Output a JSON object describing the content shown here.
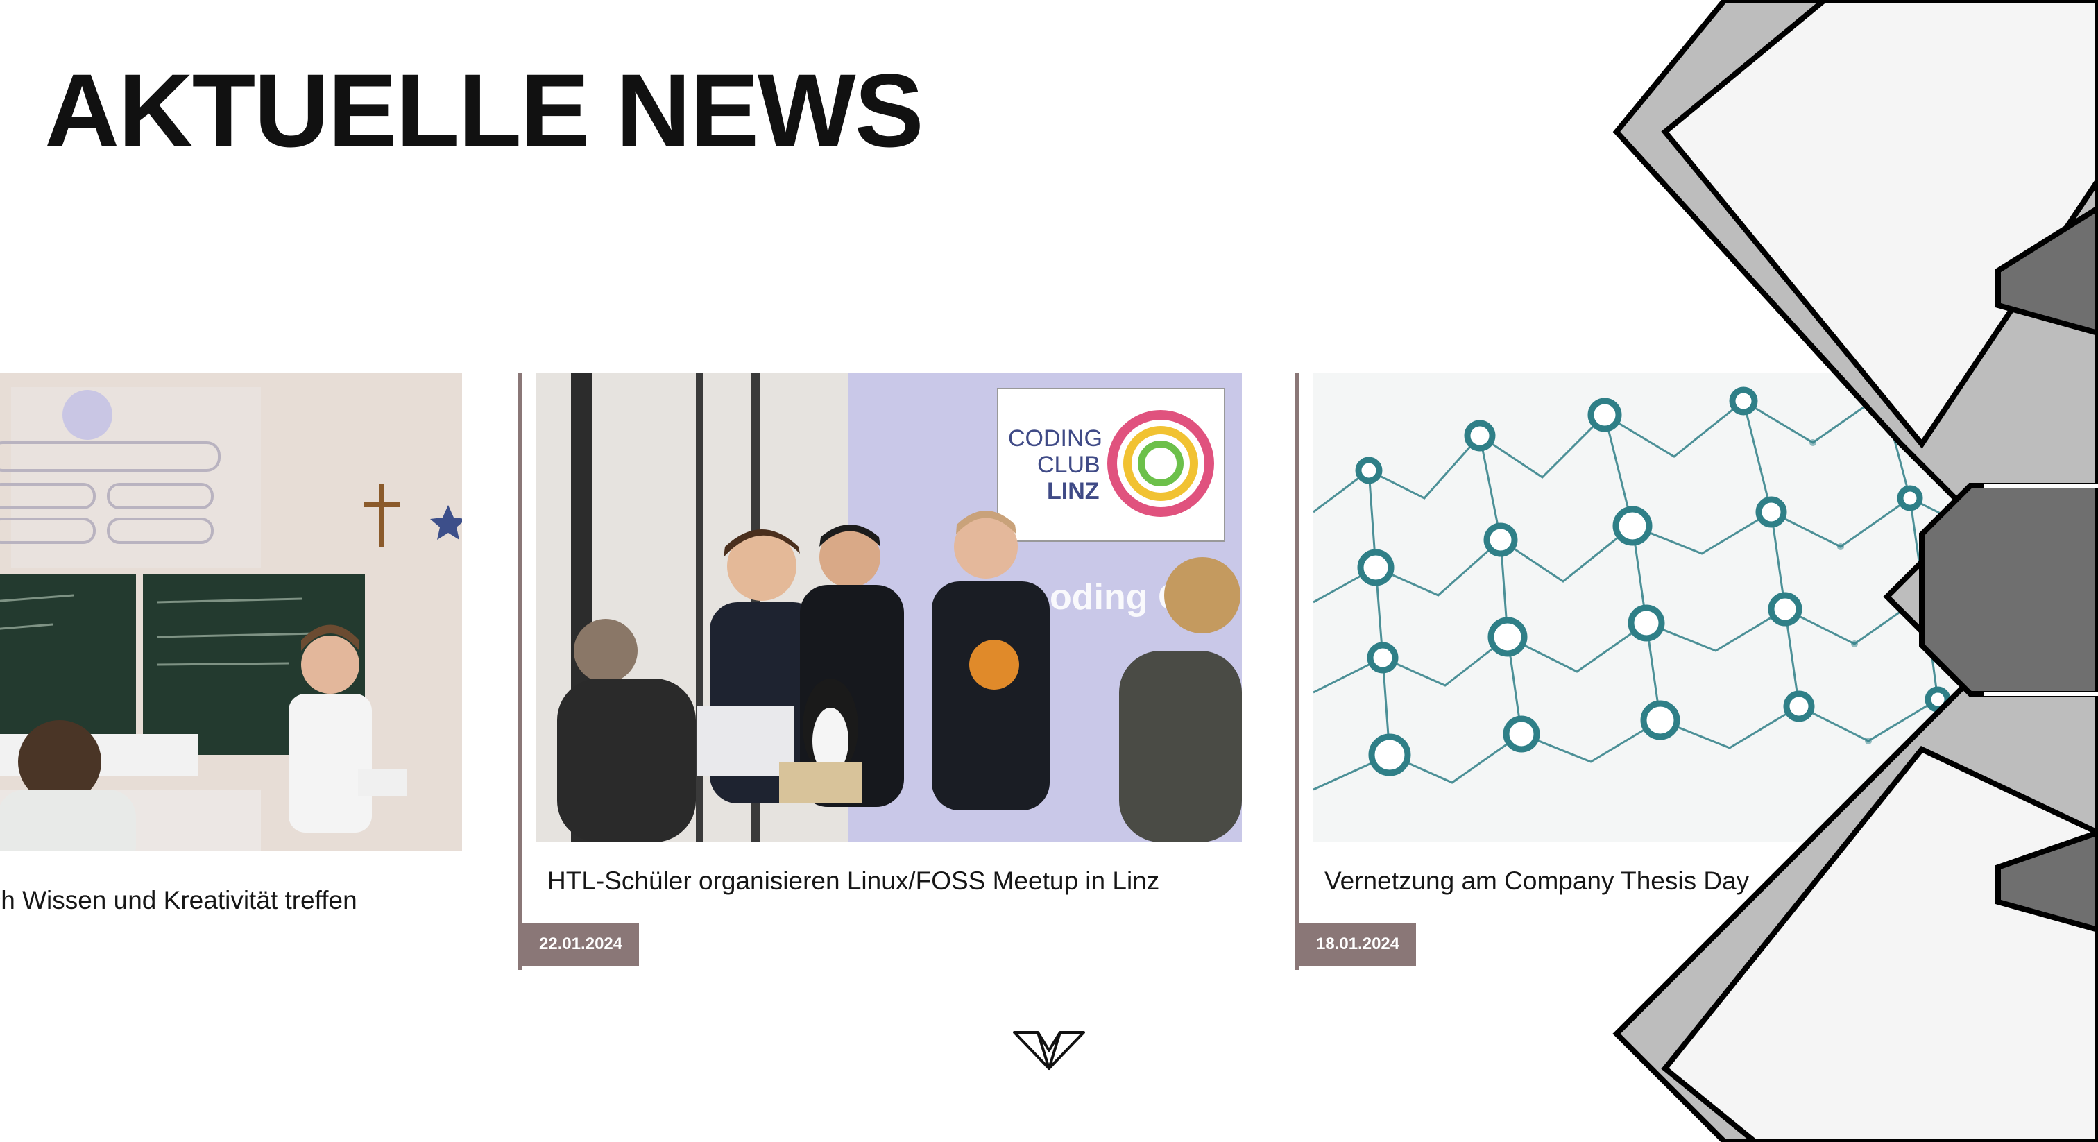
{
  "page": {
    "title": "AKTUELLE NEWS"
  },
  "news": [
    {
      "title": "sich Wissen und Kreativität treffen",
      "date": ""
    },
    {
      "title": "HTL-Schüler organisieren Linux/FOSS Meetup in Linz",
      "date": "22.01.2024",
      "image_sign_lines": [
        "CODING",
        "CLUB",
        "LINZ"
      ],
      "image_banner": "oding Clu"
    },
    {
      "title": "Vernetzung am Company Thesis Day",
      "date": "18.01.2024"
    }
  ],
  "icons": {
    "scroll_logo": "chevron-logo-icon"
  },
  "colors": {
    "accent": "#8a7777",
    "teal": "#2f7f87",
    "text": "#111111"
  }
}
